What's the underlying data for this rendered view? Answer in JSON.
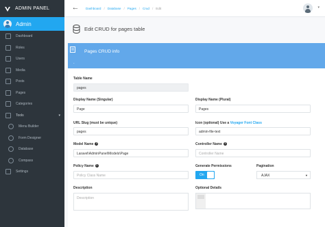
{
  "app": {
    "title": "ADMIN PANEL"
  },
  "user": {
    "name": "Admin"
  },
  "sidebar": {
    "items": [
      {
        "label": "Dashboard",
        "icon": "dashboard-icon"
      },
      {
        "label": "Roles",
        "icon": "lock-icon"
      },
      {
        "label": "Users",
        "icon": "person-icon"
      },
      {
        "label": "Media",
        "icon": "images-icon"
      },
      {
        "label": "Posts",
        "icon": "news-icon"
      },
      {
        "label": "Pages",
        "icon": "file-text-icon"
      },
      {
        "label": "Categories",
        "icon": "categories-icon"
      },
      {
        "label": "Tools",
        "icon": "tools-icon"
      },
      {
        "label": "Menu Builder",
        "icon": "list-icon"
      },
      {
        "label": "Form Designer",
        "icon": "code-icon"
      },
      {
        "label": "Database",
        "icon": "data-icon"
      },
      {
        "label": "Compass",
        "icon": "compass-icon"
      },
      {
        "label": "Settings",
        "icon": "settings-icon"
      }
    ]
  },
  "breadcrumb": {
    "items": [
      "Dashboard",
      "Database",
      "Pages",
      "Crud",
      "Edit"
    ]
  },
  "page": {
    "title": "Edit CRUD for pages table"
  },
  "panel": {
    "title": "Pages CRUD info",
    "marker": "."
  },
  "form": {
    "table_name": {
      "label": "Table Name",
      "value": "pages"
    },
    "display_singular": {
      "label": "Display Name (Singular)",
      "value": "Page"
    },
    "display_plural": {
      "label": "Display Name (Plural)",
      "value": "Pages"
    },
    "slug": {
      "label": "URL Slug (must be unique)",
      "value": "pages"
    },
    "icon": {
      "label_prefix": "Icon (optional) Use a ",
      "label_link": "Voyager Font Class",
      "value": "admin-file-text"
    },
    "model_name": {
      "label": "Model Name",
      "value": "Laravel\\AdminPanel\\Models\\Page"
    },
    "controller_name": {
      "label": "Controller Name",
      "placeholder": "Controller Name"
    },
    "policy_name": {
      "label": "Policy Name",
      "placeholder": "Policy Class Name"
    },
    "generate_permissions": {
      "label": "Generate Permissions",
      "state": "On"
    },
    "pagination": {
      "label": "Pagination",
      "value": "AJAX"
    },
    "description": {
      "label": "Description",
      "placeholder": "Description"
    },
    "optional_details": {
      "label": "Optional Details"
    }
  },
  "colors": {
    "sidebar_bg": "#2d353c",
    "accent": "#22a7f0",
    "panel_header": "#62a8ea"
  }
}
